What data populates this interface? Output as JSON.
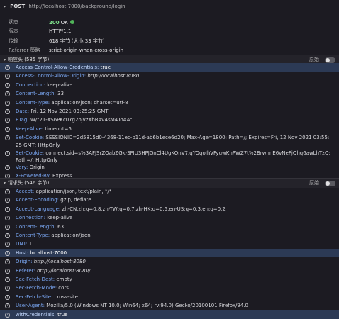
{
  "request_line": {
    "method": "POST",
    "url": "http://localhost:7000/background/login"
  },
  "summary": [
    {
      "label": "状态",
      "value": "200",
      "extra": "OK",
      "has_dot": true
    },
    {
      "label": "版本",
      "value": "HTTP/1.1"
    },
    {
      "label": "传输",
      "value": "618 字节 (大小 33 字节)"
    },
    {
      "label": "Referrer 策略",
      "value": "strict-origin-when-cross-origin"
    }
  ],
  "response_section": {
    "title": "响应头 (585 字节)",
    "raw_label": "原始"
  },
  "response_headers": [
    {
      "name": "Access-Control-Allow-Credentials:",
      "value": "true",
      "italic": false,
      "selected": true
    },
    {
      "name": "Access-Control-Allow-Origin:",
      "value": "http://localhost:8080",
      "italic": true,
      "selected": false
    },
    {
      "name": "Connection:",
      "value": "keep-alive",
      "italic": false,
      "selected": false
    },
    {
      "name": "Content-Length:",
      "value": "33",
      "italic": false,
      "selected": false
    },
    {
      "name": "Content-Type:",
      "value": "application/json; charset=utf-8",
      "italic": false,
      "selected": false
    },
    {
      "name": "Date:",
      "value": "Fri, 12 Nov 2021 03:25:25 GMT",
      "italic": false,
      "selected": false
    },
    {
      "name": "ETag:",
      "value": "W/\"21-XS6PKc0Yg2ojvzXbBAV4sM4ToAA\"",
      "italic": false,
      "selected": false
    },
    {
      "name": "Keep-Alive:",
      "value": "timeout=5",
      "italic": false,
      "selected": false
    },
    {
      "name": "Set-Cookie:",
      "value": "SESSIONID=2d5815d0-4368-11ec-b11d-ab6b1ece6d20; Max-Age=1800; Path=/; Expires=Fri, 12 Nov 2021 03:55:25 GMT; HttpOnly",
      "italic": false,
      "selected": false
    },
    {
      "name": "Set-Cookie:",
      "value": "connect.sid=s%3AFJSrZOabZGk-SFIU3HPJGnCl4UgKOnV7.qYOqoIhVFyuwKnPWZ7t%2BrwhnE6vNeFjQhq6awLhTzQ; Path=/; HttpOnly",
      "italic": false,
      "selected": false
    },
    {
      "name": "Vary:",
      "value": "Origin",
      "italic": false,
      "selected": false
    },
    {
      "name": "X-Powered-By:",
      "value": "Express",
      "italic": false,
      "selected": false
    }
  ],
  "request_section": {
    "title": "请求头 (546 字节)",
    "raw_label": "原始"
  },
  "request_headers": [
    {
      "name": "Accept:",
      "value": "application/json, text/plain, */*",
      "italic": false,
      "selected": false
    },
    {
      "name": "Accept-Encoding:",
      "value": "gzip, deflate",
      "italic": false,
      "selected": false
    },
    {
      "name": "Accept-Language:",
      "value": "zh-CN,zh;q=0.8,zh-TW;q=0.7,zh-HK;q=0.5,en-US;q=0.3,en;q=0.2",
      "italic": false,
      "selected": false
    },
    {
      "name": "Connection:",
      "value": "keep-alive",
      "italic": false,
      "selected": false
    },
    {
      "name": "Content-Length:",
      "value": "63",
      "italic": false,
      "selected": false
    },
    {
      "name": "Content-Type:",
      "value": "application/json",
      "italic": false,
      "selected": false
    },
    {
      "name": "DNT:",
      "value": "1",
      "italic": false,
      "selected": false
    },
    {
      "name": "Host:",
      "value": "localhost:7000",
      "italic": false,
      "selected": true
    },
    {
      "name": "Origin:",
      "value": "http://localhost:8080",
      "italic": true,
      "selected": false
    },
    {
      "name": "Referer:",
      "value": "http://localhost:8080/",
      "italic": true,
      "selected": false
    },
    {
      "name": "Sec-Fetch-Dest:",
      "value": "empty",
      "italic": false,
      "selected": false
    },
    {
      "name": "Sec-Fetch-Mode:",
      "value": "cors",
      "italic": false,
      "selected": false
    },
    {
      "name": "Sec-Fetch-Site:",
      "value": "cross-site",
      "italic": false,
      "selected": false
    },
    {
      "name": "User-Agent:",
      "value": "Mozilla/5.0 (Windows NT 10.0; Win64; x64; rv:94.0) Gecko/20100101 Firefox/94.0",
      "italic": false,
      "selected": false
    },
    {
      "name": "withCredentials:",
      "value": "true",
      "italic": false,
      "selected": true
    }
  ],
  "colors": {
    "background": "#1c1b22",
    "header_name": "#7aa7f3",
    "selected_row": "#2c3a55",
    "status_ok": "#51b55a"
  },
  "icons": {
    "row_help": "question-circle-icon",
    "section_toggle": "disclosure-triangle-icon",
    "raw_switch": "toggle-switch-icon"
  }
}
